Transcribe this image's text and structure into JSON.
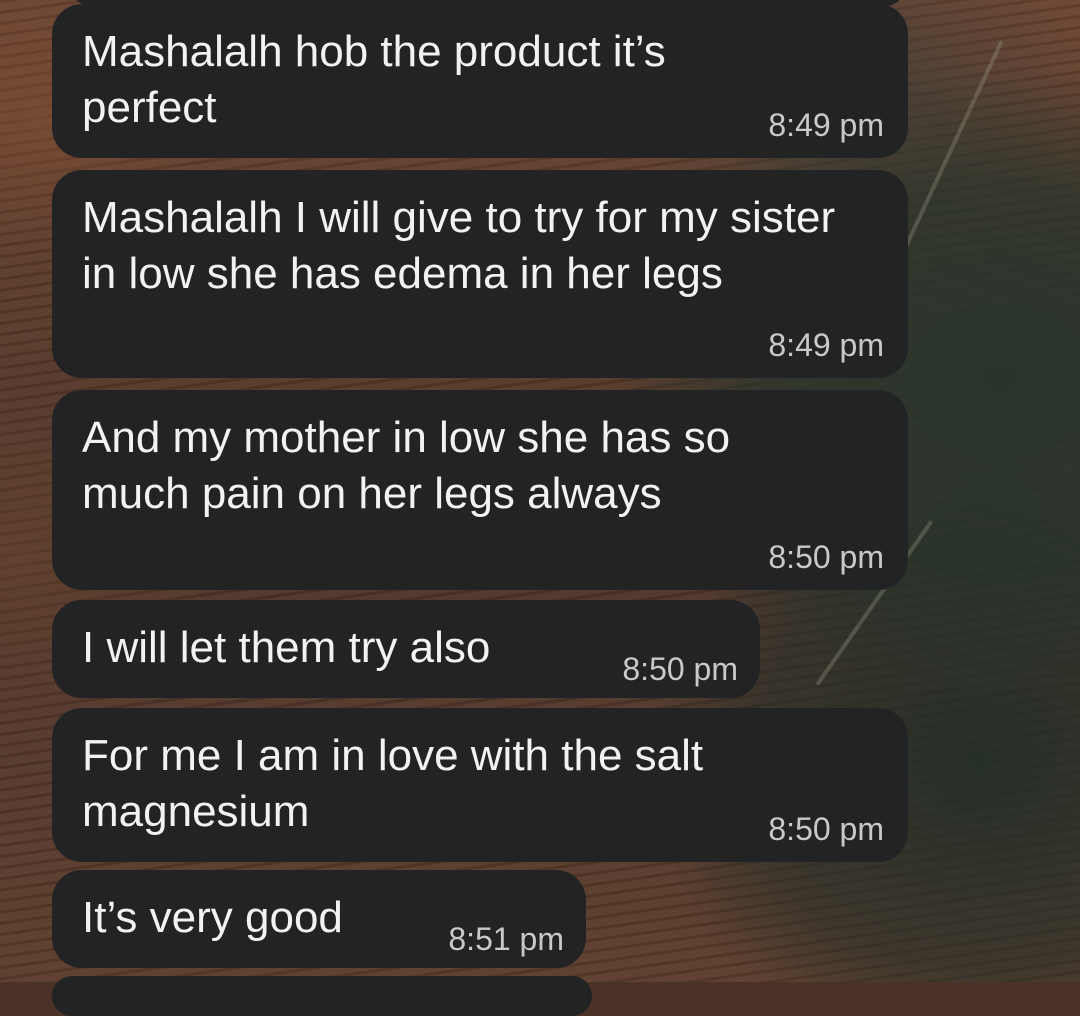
{
  "chat": {
    "messages": [
      {
        "text": "Mashalalh hob the product it’s perfect",
        "time": "8:49 pm"
      },
      {
        "text": "Mashalalh I will give to try for my sister in low she has edema in her legs",
        "time": "8:49 pm"
      },
      {
        "text": "And my mother in low she has so much pain on her legs always",
        "time": "8:50 pm"
      },
      {
        "text": "I will let them try also",
        "time": "8:50 pm"
      },
      {
        "text": "For me I am in love with the salt magnesium",
        "time": "8:50 pm"
      },
      {
        "text": "It’s very good",
        "time": "8:51 pm"
      }
    ]
  },
  "colors": {
    "bubble": "#222324",
    "message_text": "#f2f2f2",
    "timestamp": "#c9c9c9"
  }
}
